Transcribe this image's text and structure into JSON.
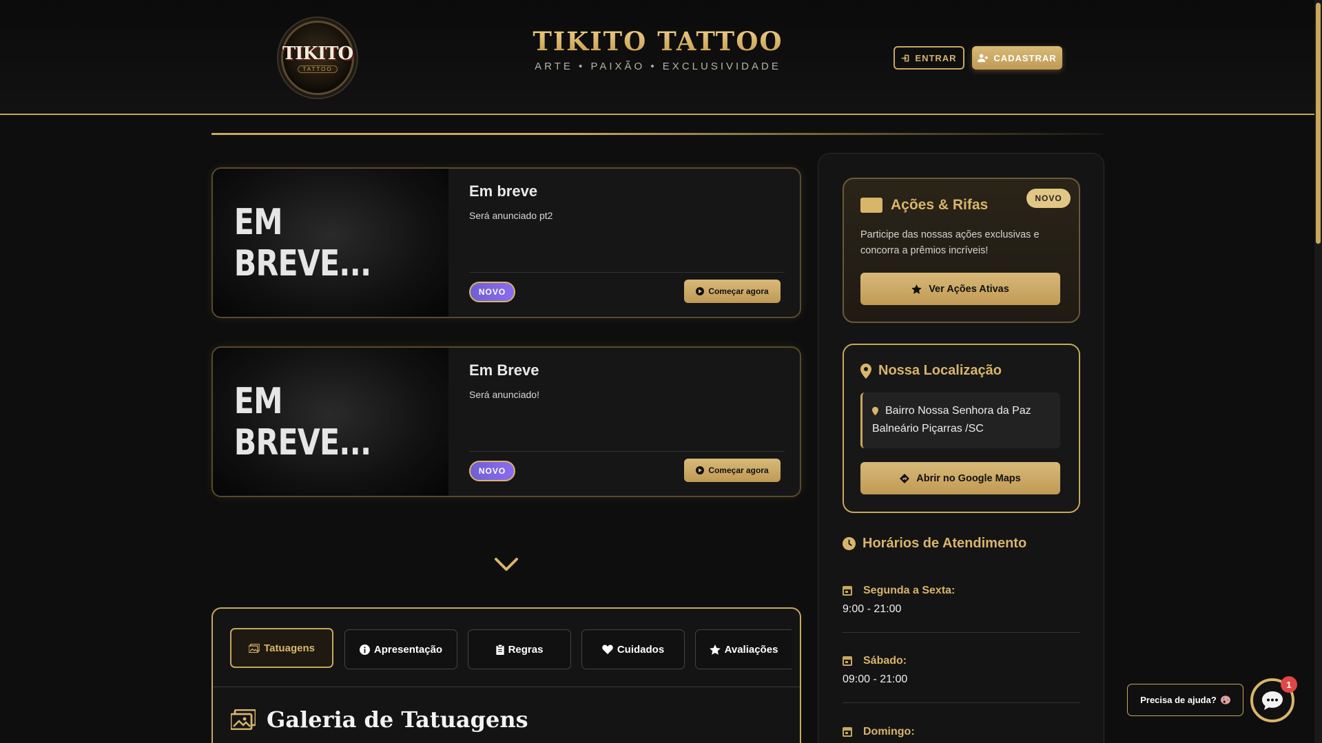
{
  "header": {
    "logo_main": "TIKITO",
    "logo_sub": "TATTOO",
    "title": "TIKITO TATTOO",
    "subtitle": "ARTE • PAIXÃO • EXCLUSIVIDADE",
    "login_label": "ENTRAR",
    "signup_label": "CADASTRAR"
  },
  "cards": [
    {
      "image_text": "EM BREVE...",
      "title": "Em breve",
      "description": "Será anunciado pt2",
      "badge": "NOVO",
      "button": "Começar agora"
    },
    {
      "image_text": "EM BREVE...",
      "title": "Em Breve",
      "description": "Será anunciado!",
      "badge": "NOVO",
      "button": "Começar agora"
    }
  ],
  "tabs": [
    {
      "label": "Tatuagens",
      "icon": "images-icon",
      "active": true
    },
    {
      "label": "Apresentação",
      "icon": "info-icon",
      "active": false
    },
    {
      "label": "Regras",
      "icon": "clipboard-icon",
      "active": false
    },
    {
      "label": "Cuidados",
      "icon": "heart-icon",
      "active": false
    },
    {
      "label": "Avaliações",
      "icon": "star-icon",
      "active": false
    }
  ],
  "gallery": {
    "title": "Galeria de Tatuagens"
  },
  "sidebar": {
    "acoes": {
      "title": "Ações & Rifas",
      "badge": "NOVO",
      "description": "Participe das nossas ações exclusivas e concorra a prêmios incríveis!",
      "button": "Ver Ações Ativas"
    },
    "location": {
      "title": "Nossa Localização",
      "address_line1": "Bairro Nossa Senhora da Paz",
      "address_line2": "Balneário Piçarras /SC",
      "button": "Abrir no Google Maps"
    },
    "hours": {
      "title": "Horários de Atendimento",
      "rows": [
        {
          "day": "Segunda a Sexta:",
          "time": "9:00 - 21:00"
        },
        {
          "day": "Sábado:",
          "time": "09:00 - 21:00"
        },
        {
          "day": "Domingo:",
          "time": ""
        }
      ]
    }
  },
  "help": {
    "label": "Precisa de ajuda?",
    "notification_count": "1"
  },
  "colors": {
    "accent_gold": "#c9a85c",
    "background": "#0e0e0e",
    "badge_purple": "#7a66e0",
    "notification_red": "#e14646"
  }
}
